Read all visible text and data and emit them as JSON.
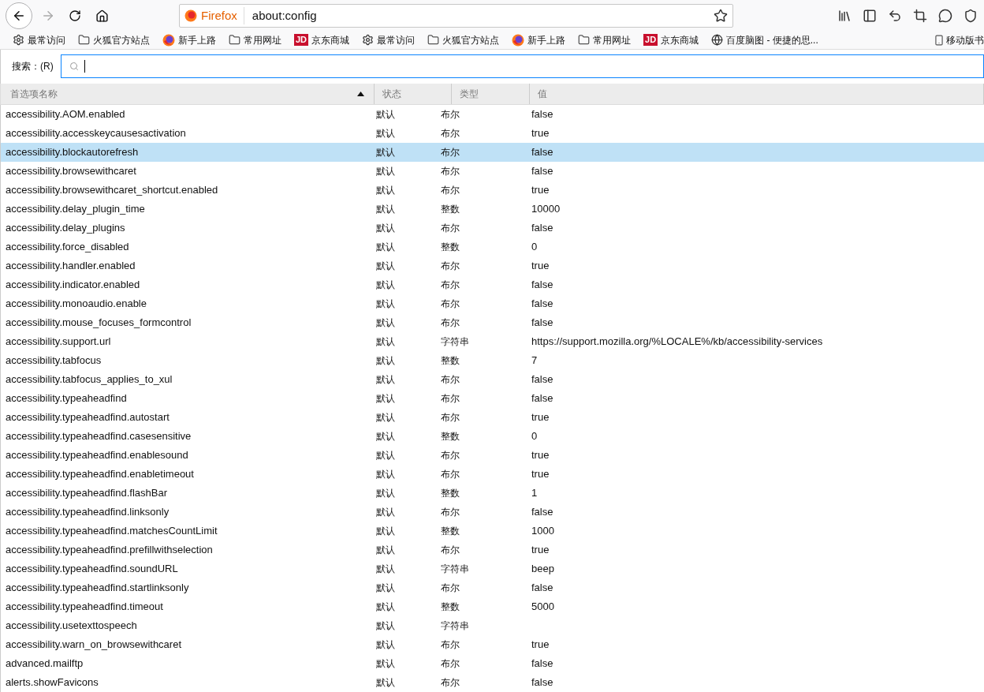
{
  "address_bar": {
    "identity": "Firefox",
    "url": "about:config"
  },
  "bookmarks": [
    {
      "kind": "gear",
      "label": "最常访问"
    },
    {
      "kind": "folder",
      "label": "火狐官方站点"
    },
    {
      "kind": "firefox",
      "label": "新手上路"
    },
    {
      "kind": "folder",
      "label": "常用网址"
    },
    {
      "kind": "jd",
      "logo": "JD",
      "label": "京东商城"
    },
    {
      "kind": "gear",
      "label": "最常访问"
    },
    {
      "kind": "folder",
      "label": "火狐官方站点"
    },
    {
      "kind": "firefox",
      "label": "新手上路"
    },
    {
      "kind": "folder",
      "label": "常用网址"
    },
    {
      "kind": "jd",
      "logo": "JD",
      "label": "京东商城"
    },
    {
      "kind": "globe",
      "label": "百度脑图 - 便捷的思..."
    }
  ],
  "mobile_bookmarks": {
    "label": "移动版书"
  },
  "search": {
    "label": "搜索：(R)"
  },
  "table": {
    "columns": [
      {
        "label": "首选项名称",
        "sorted": true
      },
      {
        "label": "状态",
        "sorted": false
      },
      {
        "label": "类型",
        "sorted": false
      },
      {
        "label": "值",
        "sorted": false
      }
    ],
    "rows": [
      {
        "name": "accessibility.AOM.enabled",
        "status": "默认",
        "type": "布尔",
        "value": "false",
        "selected": false
      },
      {
        "name": "accessibility.accesskeycausesactivation",
        "status": "默认",
        "type": "布尔",
        "value": "true",
        "selected": false
      },
      {
        "name": "accessibility.blockautorefresh",
        "status": "默认",
        "type": "布尔",
        "value": "false",
        "selected": true
      },
      {
        "name": "accessibility.browsewithcaret",
        "status": "默认",
        "type": "布尔",
        "value": "false",
        "selected": false
      },
      {
        "name": "accessibility.browsewithcaret_shortcut.enabled",
        "status": "默认",
        "type": "布尔",
        "value": "true",
        "selected": false
      },
      {
        "name": "accessibility.delay_plugin_time",
        "status": "默认",
        "type": "整数",
        "value": "10000",
        "selected": false
      },
      {
        "name": "accessibility.delay_plugins",
        "status": "默认",
        "type": "布尔",
        "value": "false",
        "selected": false
      },
      {
        "name": "accessibility.force_disabled",
        "status": "默认",
        "type": "整数",
        "value": "0",
        "selected": false
      },
      {
        "name": "accessibility.handler.enabled",
        "status": "默认",
        "type": "布尔",
        "value": "true",
        "selected": false
      },
      {
        "name": "accessibility.indicator.enabled",
        "status": "默认",
        "type": "布尔",
        "value": "false",
        "selected": false
      },
      {
        "name": "accessibility.monoaudio.enable",
        "status": "默认",
        "type": "布尔",
        "value": "false",
        "selected": false
      },
      {
        "name": "accessibility.mouse_focuses_formcontrol",
        "status": "默认",
        "type": "布尔",
        "value": "false",
        "selected": false
      },
      {
        "name": "accessibility.support.url",
        "status": "默认",
        "type": "字符串",
        "value": "https://support.mozilla.org/%LOCALE%/kb/accessibility-services",
        "selected": false
      },
      {
        "name": "accessibility.tabfocus",
        "status": "默认",
        "type": "整数",
        "value": "7",
        "selected": false
      },
      {
        "name": "accessibility.tabfocus_applies_to_xul",
        "status": "默认",
        "type": "布尔",
        "value": "false",
        "selected": false
      },
      {
        "name": "accessibility.typeaheadfind",
        "status": "默认",
        "type": "布尔",
        "value": "false",
        "selected": false
      },
      {
        "name": "accessibility.typeaheadfind.autostart",
        "status": "默认",
        "type": "布尔",
        "value": "true",
        "selected": false
      },
      {
        "name": "accessibility.typeaheadfind.casesensitive",
        "status": "默认",
        "type": "整数",
        "value": "0",
        "selected": false
      },
      {
        "name": "accessibility.typeaheadfind.enablesound",
        "status": "默认",
        "type": "布尔",
        "value": "true",
        "selected": false
      },
      {
        "name": "accessibility.typeaheadfind.enabletimeout",
        "status": "默认",
        "type": "布尔",
        "value": "true",
        "selected": false
      },
      {
        "name": "accessibility.typeaheadfind.flashBar",
        "status": "默认",
        "type": "整数",
        "value": "1",
        "selected": false
      },
      {
        "name": "accessibility.typeaheadfind.linksonly",
        "status": "默认",
        "type": "布尔",
        "value": "false",
        "selected": false
      },
      {
        "name": "accessibility.typeaheadfind.matchesCountLimit",
        "status": "默认",
        "type": "整数",
        "value": "1000",
        "selected": false
      },
      {
        "name": "accessibility.typeaheadfind.prefillwithselection",
        "status": "默认",
        "type": "布尔",
        "value": "true",
        "selected": false
      },
      {
        "name": "accessibility.typeaheadfind.soundURL",
        "status": "默认",
        "type": "字符串",
        "value": "beep",
        "selected": false
      },
      {
        "name": "accessibility.typeaheadfind.startlinksonly",
        "status": "默认",
        "type": "布尔",
        "value": "false",
        "selected": false
      },
      {
        "name": "accessibility.typeaheadfind.timeout",
        "status": "默认",
        "type": "整数",
        "value": "5000",
        "selected": false
      },
      {
        "name": "accessibility.usetexttospeech",
        "status": "默认",
        "type": "字符串",
        "selected": false
      },
      {
        "name": "accessibility.warn_on_browsewithcaret",
        "status": "默认",
        "type": "布尔",
        "value": "true",
        "selected": false
      },
      {
        "name": "advanced.mailftp",
        "status": "默认",
        "type": "布尔",
        "value": "false",
        "selected": false
      },
      {
        "name": "alerts.showFavicons",
        "status": "默认",
        "type": "布尔",
        "value": "false",
        "selected": false
      }
    ]
  }
}
